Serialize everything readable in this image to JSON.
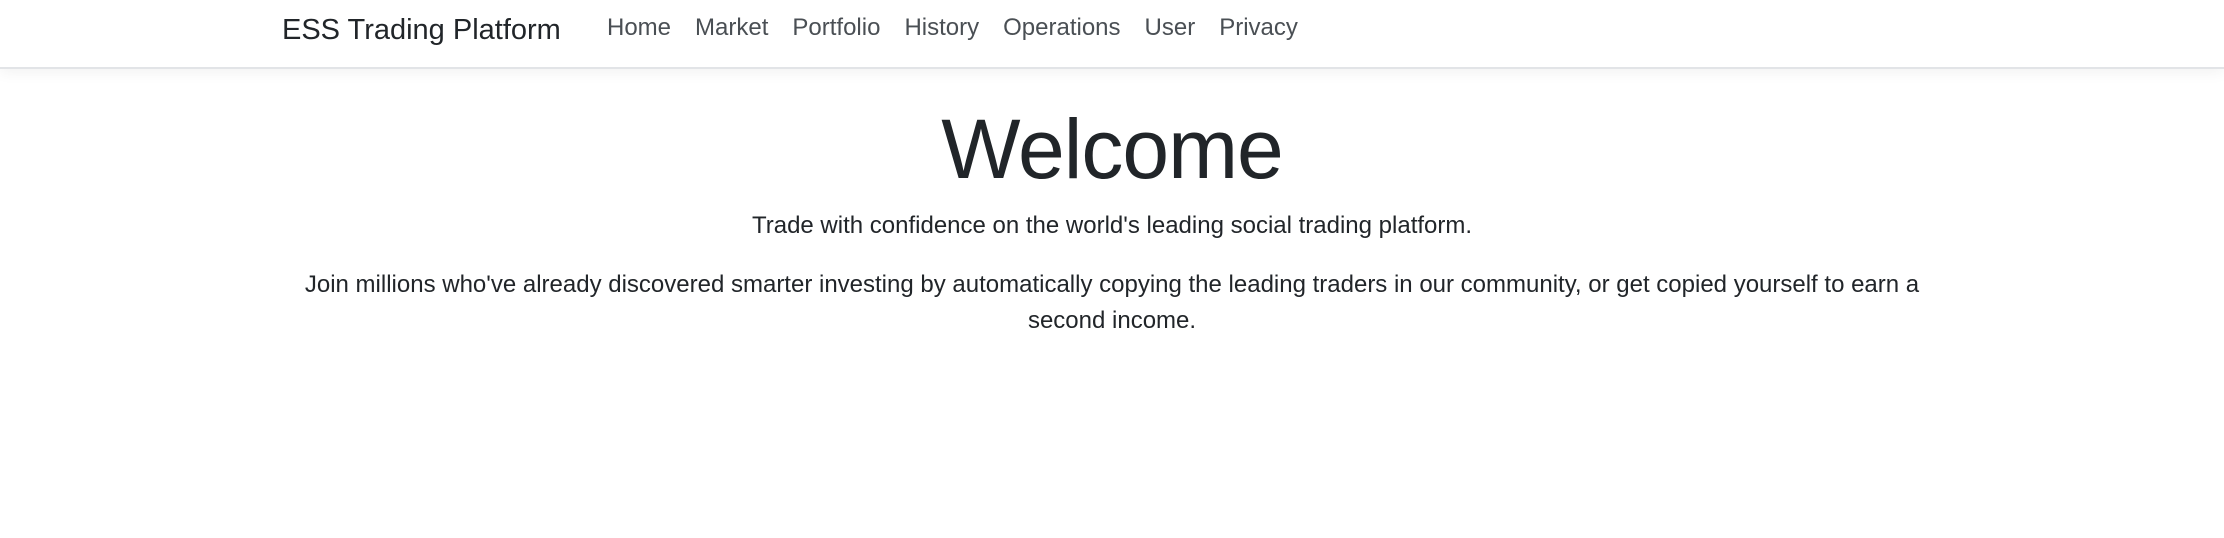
{
  "navbar": {
    "brand": "ESS Trading Platform",
    "links": [
      "Home",
      "Market",
      "Portfolio",
      "History",
      "Operations",
      "User",
      "Privacy"
    ]
  },
  "main": {
    "title": "Welcome",
    "tagline": "Trade with confidence on the world's leading social trading platform.",
    "description": "Join millions who've already discovered smarter investing by automatically copying the leading traders in our community, or get copied yourself to earn a second income."
  }
}
